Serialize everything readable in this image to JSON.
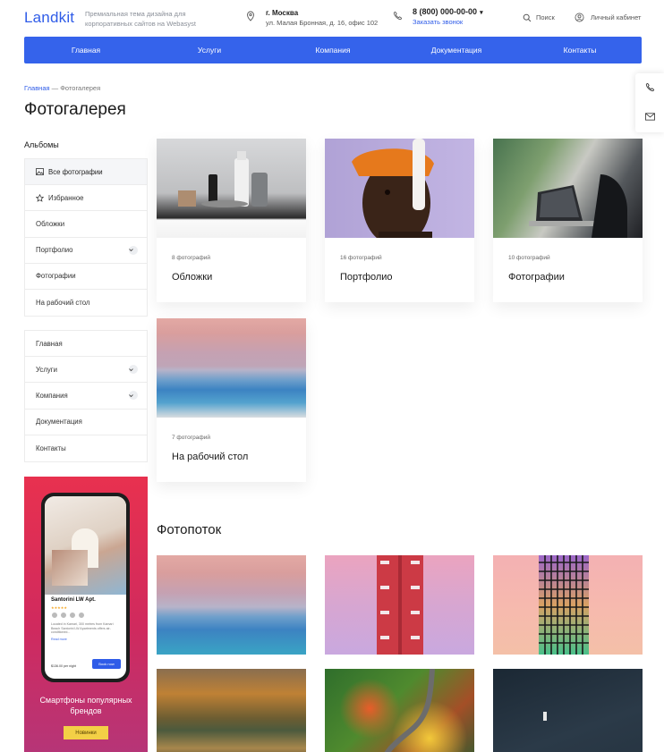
{
  "header": {
    "logo": "Landkit",
    "tagline": "Премиальная тема дизайна для корпоративных сайтов на Webasyst",
    "city": "г. Москва",
    "address": "ул. Малая Бронная, д. 16, офис 102",
    "phone": "8 (800) 000-00-00",
    "callback": "Заказать звонок",
    "search": "Поиск",
    "account": "Личный кабинет"
  },
  "nav": [
    "Главная",
    "Услуги",
    "Компания",
    "Документация",
    "Контакты"
  ],
  "breadcrumb": {
    "home": "Главная",
    "sep": "—",
    "current": "Фотогалерея"
  },
  "page_title": "Фотогалерея",
  "albums": {
    "heading": "Альбомы",
    "items": [
      "Все фотографии",
      "Избранное",
      "Обложки",
      "Портфолио",
      "Фотографии",
      "На рабочий стол"
    ]
  },
  "site_menu": [
    "Главная",
    "Услуги",
    "Компания",
    "Документация",
    "Контакты"
  ],
  "promo": {
    "app_title": "Santorini LW Apt.",
    "app_text": "Located in Kamari, 300 metres from Kamari Beach Santorini LW Apartments offers air-conditioned...",
    "read_more": "Read more",
    "price": "$136.00 per night",
    "book": "Book now",
    "title": "Смартфоны популярных брендов",
    "button": "Новинки"
  },
  "album_cards": [
    {
      "count": "8 фотографий",
      "name": "Обложки"
    },
    {
      "count": "16 фотографий",
      "name": "Портфолио"
    },
    {
      "count": "10 фотографий",
      "name": "Фотографии"
    },
    {
      "count": "7 фотографий",
      "name": "На рабочий стол"
    }
  ],
  "photostream_title": "Фотопоток",
  "colors": {
    "accent": "#3563eb",
    "promo_button": "#f3d046"
  }
}
